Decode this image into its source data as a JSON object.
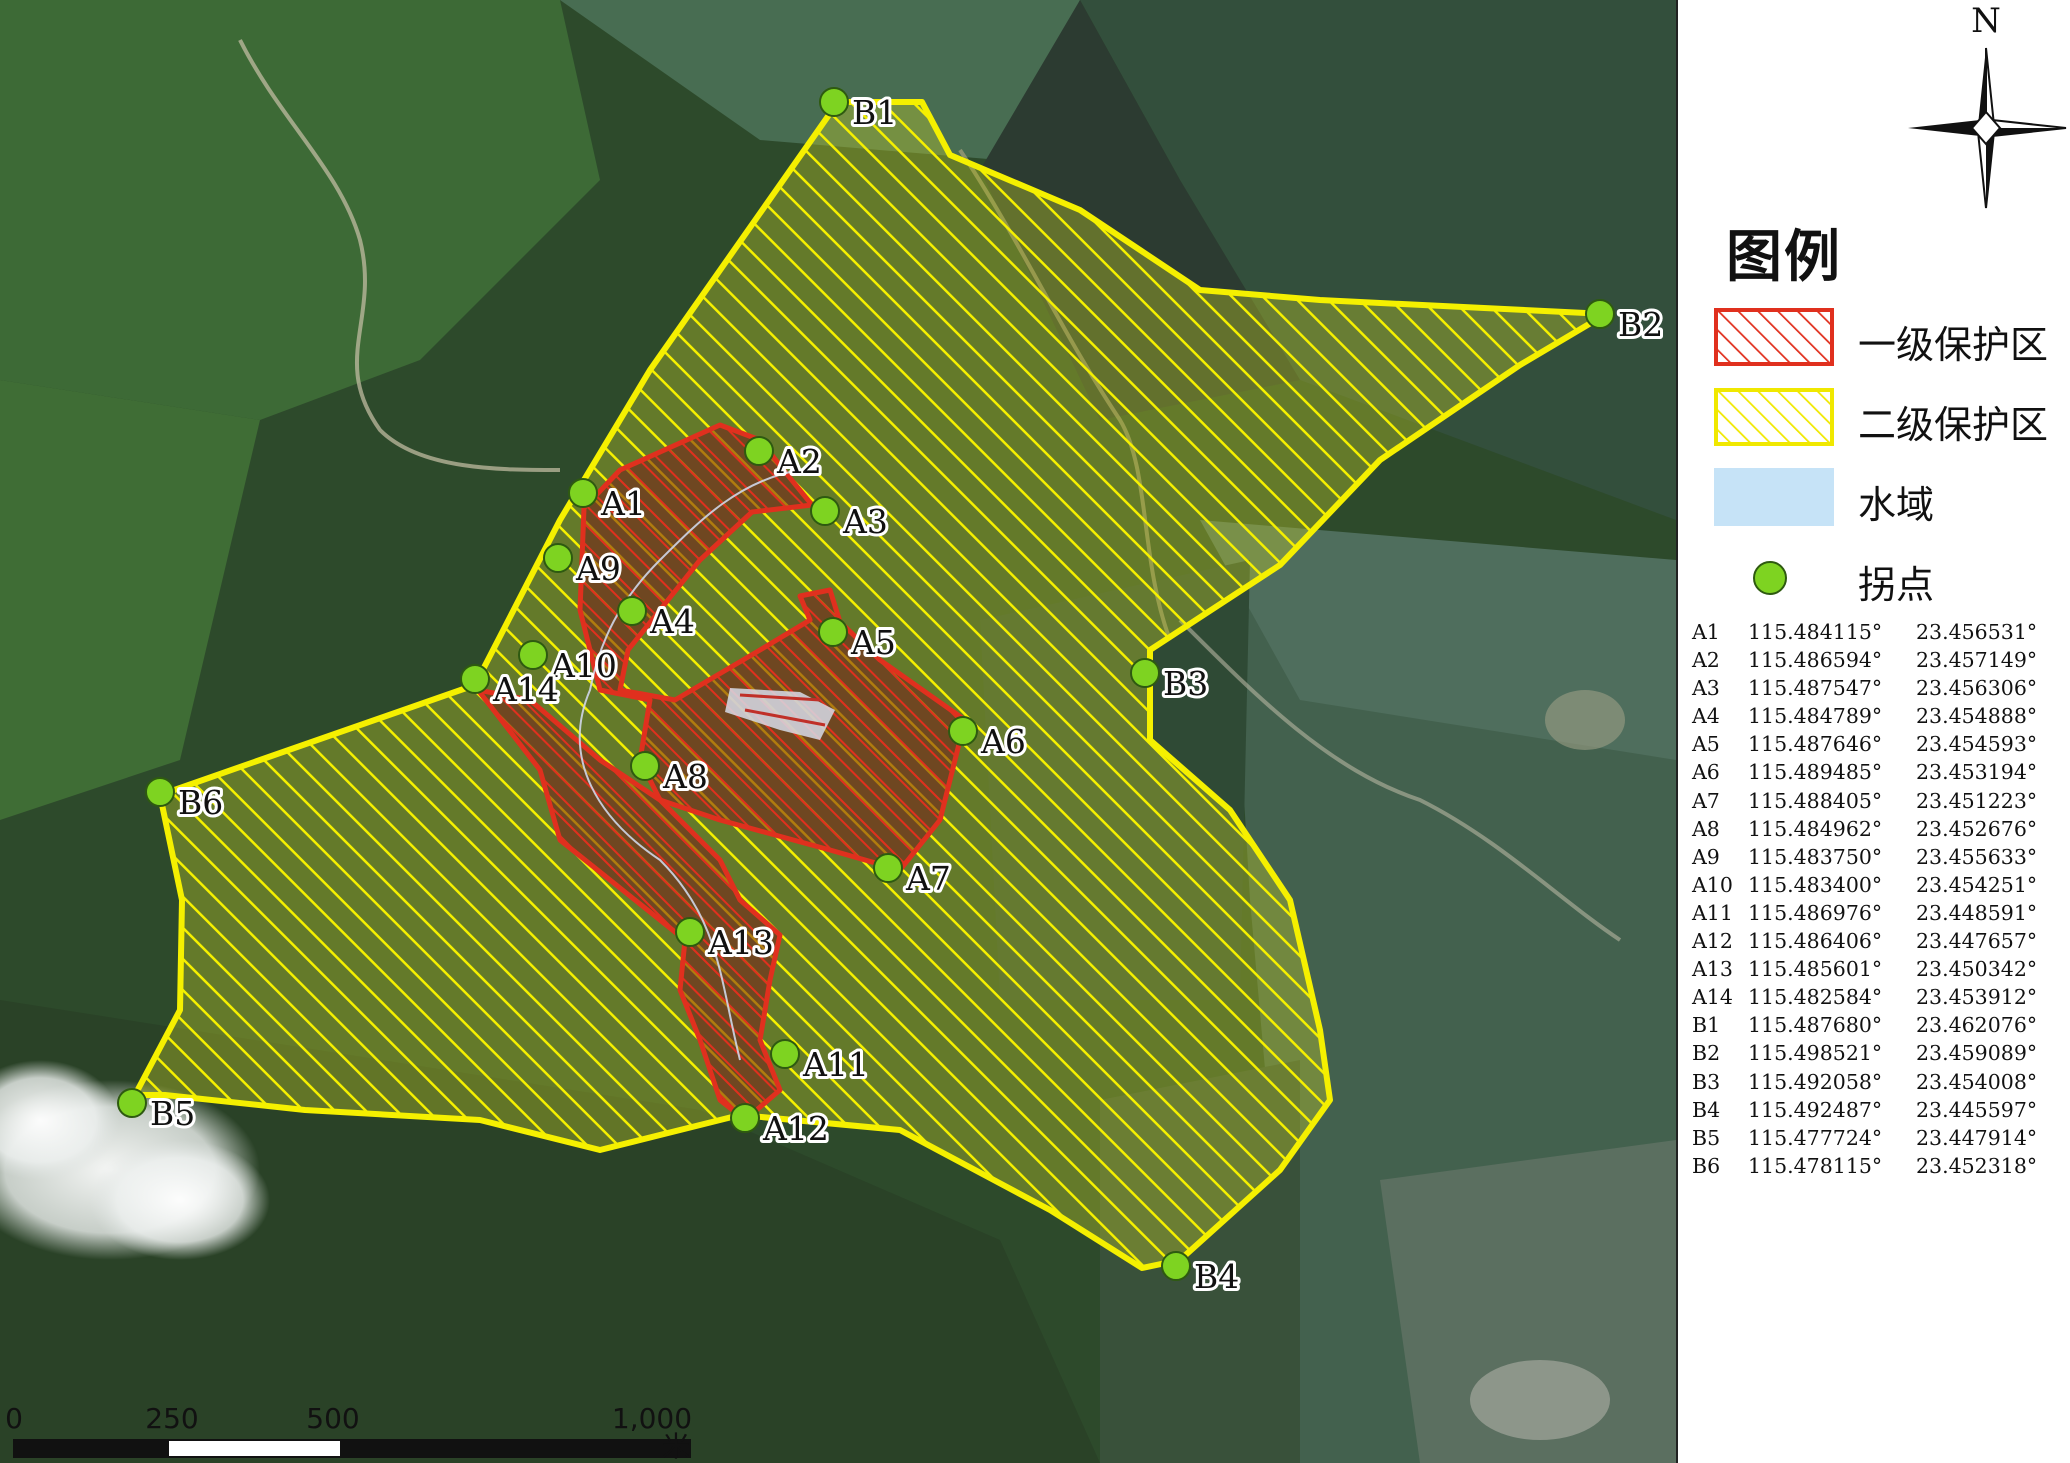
{
  "legend": {
    "title": "图例",
    "items": [
      {
        "label": "一级保护区",
        "kind": "zone1",
        "color": "#e0301e"
      },
      {
        "label": "二级保护区",
        "kind": "zone2",
        "color": "#f5f000"
      },
      {
        "label": "水域",
        "kind": "water",
        "color": "#c6e3f7"
      },
      {
        "label": "拐点",
        "kind": "point",
        "color": "#7ed321"
      }
    ]
  },
  "north_arrow": {
    "label": "N"
  },
  "scale_bar": {
    "ticks": [
      "0",
      "250",
      "500",
      "1,000"
    ],
    "unit": "米"
  },
  "points": [
    {
      "id": "A1",
      "lon": "115.484115°",
      "lat": "23.456531°"
    },
    {
      "id": "A2",
      "lon": "115.486594°",
      "lat": "23.457149°"
    },
    {
      "id": "A3",
      "lon": "115.487547°",
      "lat": "23.456306°"
    },
    {
      "id": "A4",
      "lon": "115.484789°",
      "lat": "23.454888°"
    },
    {
      "id": "A5",
      "lon": "115.487646°",
      "lat": "23.454593°"
    },
    {
      "id": "A6",
      "lon": "115.489485°",
      "lat": "23.453194°"
    },
    {
      "id": "A7",
      "lon": "115.488405°",
      "lat": "23.451223°"
    },
    {
      "id": "A8",
      "lon": "115.484962°",
      "lat": "23.452676°"
    },
    {
      "id": "A9",
      "lon": "115.483750°",
      "lat": "23.455633°"
    },
    {
      "id": "A10",
      "lon": "115.483400°",
      "lat": "23.454251°"
    },
    {
      "id": "A11",
      "lon": "115.486976°",
      "lat": "23.448591°"
    },
    {
      "id": "A12",
      "lon": "115.486406°",
      "lat": "23.447657°"
    },
    {
      "id": "A13",
      "lon": "115.485601°",
      "lat": "23.450342°"
    },
    {
      "id": "A14",
      "lon": "115.482584°",
      "lat": "23.453912°"
    },
    {
      "id": "B1",
      "lon": "115.487680°",
      "lat": "23.462076°"
    },
    {
      "id": "B2",
      "lon": "115.498521°",
      "lat": "23.459089°"
    },
    {
      "id": "B3",
      "lon": "115.492058°",
      "lat": "23.454008°"
    },
    {
      "id": "B4",
      "lon": "115.492487°",
      "lat": "23.445597°"
    },
    {
      "id": "B5",
      "lon": "115.477724°",
      "lat": "23.447914°"
    },
    {
      "id": "B6",
      "lon": "115.478115°",
      "lat": "23.452318°"
    }
  ]
}
